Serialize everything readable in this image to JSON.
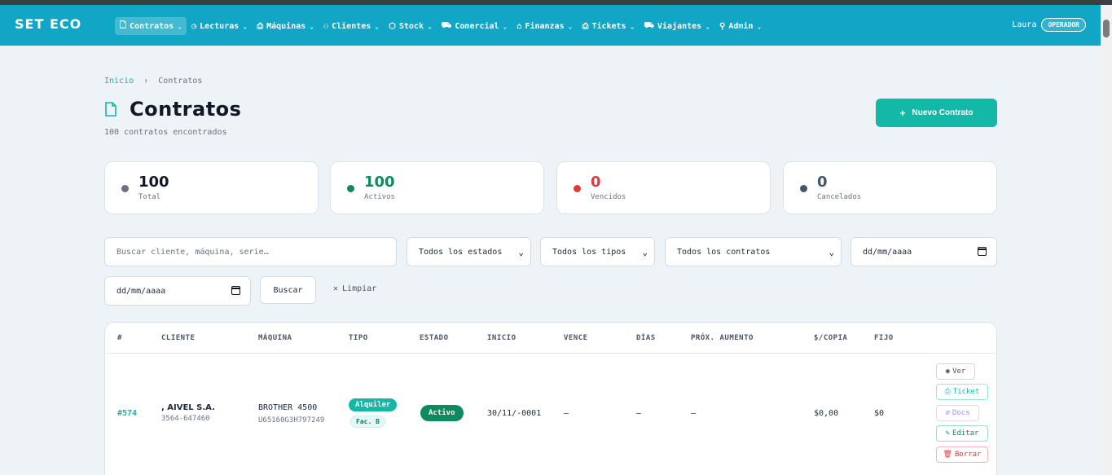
{
  "app": {
    "logo": "SET ECO",
    "user_name": "Laura",
    "role": "OPERADOR"
  },
  "nav": {
    "items": [
      {
        "label": "Contratos",
        "icon": "file-icon",
        "active": true
      },
      {
        "label": "Lecturas",
        "icon": "clock-icon",
        "active": false
      },
      {
        "label": "Máquinas",
        "icon": "printer-icon",
        "active": false
      },
      {
        "label": "Clientes",
        "icon": "users-icon",
        "active": false
      },
      {
        "label": "Stock",
        "icon": "box-icon",
        "active": false
      },
      {
        "label": "Comercial",
        "icon": "cart-icon",
        "active": false
      },
      {
        "label": "Finanzas",
        "icon": "bank-icon",
        "active": false
      },
      {
        "label": "Tickets",
        "icon": "printer-icon",
        "active": false
      },
      {
        "label": "Viajantes",
        "icon": "truck-icon",
        "active": false
      },
      {
        "label": "Admin",
        "icon": "user-icon",
        "active": false
      }
    ]
  },
  "breadcrumb": {
    "home": "Inicio",
    "separator": "›",
    "current": "Contratos"
  },
  "page": {
    "title": "Contratos",
    "subtitle": "100 contratos encontrados",
    "new_button": "Nuevo Contrato",
    "new_button_icon": "+"
  },
  "stats": [
    {
      "value": "100",
      "label": "Total",
      "color": "#6b7280",
      "value_color": "#111827"
    },
    {
      "value": "100",
      "label": "Activos",
      "color": "#0f8a5f",
      "value_color": "#0f8a5f"
    },
    {
      "value": "0",
      "label": "Vencidos",
      "color": "#dc3c3c",
      "value_color": "#dc3c3c"
    },
    {
      "value": "0",
      "label": "Cancelados",
      "color": "#475569",
      "value_color": "#475569"
    }
  ],
  "filters": {
    "search_placeholder": "Buscar cliente, máquina, serie…",
    "estado": "Todos los estados",
    "tipo": "Todos los tipos",
    "contratos": "Todos los contratos",
    "date_from": "dd/mm/aaaa",
    "date_to": "dd/mm/aaaa",
    "search_button": "Buscar",
    "clear": "Limpiar"
  },
  "table": {
    "headers": [
      "#",
      "CLIENTE",
      "MÁQUINA",
      "TIPO",
      "ESTADO",
      "INICIO",
      "VENCE",
      "DÍAS",
      "PRÓX. AUMENTO",
      "$/COPIA",
      "FIJO"
    ],
    "rows": [
      {
        "id": "#574",
        "client": ", AIVEL S.A.",
        "phone": "3564-647460",
        "machine": "BROTHER 4500",
        "serial": "U65160G3H797249",
        "tipo": "Alquiler",
        "fac": "Fac. B",
        "estado": "Activo",
        "inicio": "30/11/-0001",
        "vence": "—",
        "dias": "–",
        "prox_aumento": "–",
        "copia": "$0,00",
        "fijo": "$0",
        "actions": [
          {
            "label": "Ver",
            "icon": "eye-icon",
            "color": "#4b5563",
            "border": "#d1d5db"
          },
          {
            "label": "Ticket",
            "icon": "printer-icon",
            "color": "#14b8a6",
            "border": "#99e6da"
          },
          {
            "label": "Docs",
            "icon": "paperclip-icon",
            "color": "#a78bfa",
            "border": "#ddd6fe"
          },
          {
            "label": "Editar",
            "icon": "edit-icon",
            "color": "#0f8a5f",
            "border": "#9fdcc3"
          },
          {
            "label": "Borrar",
            "icon": "trash-icon",
            "color": "#dc3c3c",
            "border": "#f5b5b5"
          }
        ]
      }
    ]
  }
}
